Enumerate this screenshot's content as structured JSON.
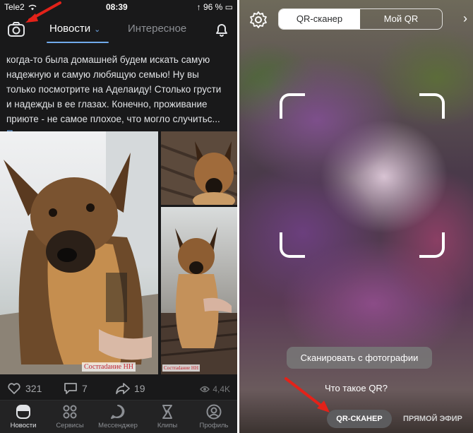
{
  "status": {
    "carrier": "Tele2",
    "time": "08:39",
    "battery": "96 %"
  },
  "header": {
    "tab_news": "Новости",
    "tab_interesting": "Интересное"
  },
  "post": {
    "lines": [
      "когда-то была домашней будем искать самую",
      "надежную и самую любящую семью! Ну вы",
      "только посмотрите на Аделаиду! Столько грусти",
      "и надежды в ее глазах. Конечно, проживание",
      "приюте - не самое плохое, что могло случитьс..."
    ],
    "more_link": "Показать полностью...",
    "watermark": "Состradание НН"
  },
  "actions": {
    "likes": "321",
    "comments": "7",
    "shares": "19",
    "views": "4,4K"
  },
  "nav": [
    {
      "label": "Новости",
      "icon": "news-icon"
    },
    {
      "label": "Сервисы",
      "icon": "services-icon"
    },
    {
      "label": "Мессенджер",
      "icon": "messenger-icon"
    },
    {
      "label": "Клипы",
      "icon": "clips-icon"
    },
    {
      "label": "Профиль",
      "icon": "profile-icon"
    }
  ],
  "scanner": {
    "seg_qr": "QR-сканер",
    "seg_my": "Мой QR",
    "scan_photo": "Сканировать с фотографии",
    "what_qr": "Что такое QR?",
    "mode_qr": "QR-СКАНЕР",
    "mode_live": "ПРЯМОЙ ЭФИР"
  },
  "colors": {
    "accent": "#71aaeb",
    "annotation_arrow": "#e32219"
  }
}
